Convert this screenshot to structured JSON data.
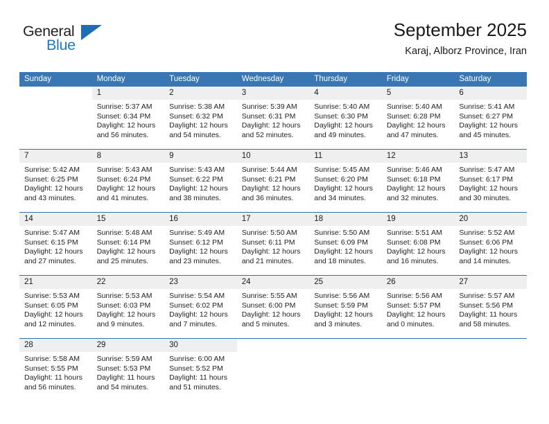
{
  "brand": {
    "name_top": "General",
    "name_bottom": "Blue",
    "triangle_color": "#1c6fb5",
    "text_color": "#231f20",
    "accent_color": "#1c7ac0"
  },
  "header": {
    "title": "September 2025",
    "subtitle": "Karaj, Alborz Province, Iran"
  },
  "theme": {
    "header_bg": "#3877b4",
    "daynum_bg": "#efefef",
    "separator": "#2f6fae",
    "text": "#1a1a1a"
  },
  "weekday_headers": [
    "Sunday",
    "Monday",
    "Tuesday",
    "Wednesday",
    "Thursday",
    "Friday",
    "Saturday"
  ],
  "weeks": [
    [
      {
        "day": "",
        "sunrise": "",
        "sunset": "",
        "daylight_line1": "",
        "daylight_line2": ""
      },
      {
        "day": "1",
        "sunrise": "Sunrise: 5:37 AM",
        "sunset": "Sunset: 6:34 PM",
        "daylight_line1": "Daylight: 12 hours",
        "daylight_line2": "and 56 minutes."
      },
      {
        "day": "2",
        "sunrise": "Sunrise: 5:38 AM",
        "sunset": "Sunset: 6:32 PM",
        "daylight_line1": "Daylight: 12 hours",
        "daylight_line2": "and 54 minutes."
      },
      {
        "day": "3",
        "sunrise": "Sunrise: 5:39 AM",
        "sunset": "Sunset: 6:31 PM",
        "daylight_line1": "Daylight: 12 hours",
        "daylight_line2": "and 52 minutes."
      },
      {
        "day": "4",
        "sunrise": "Sunrise: 5:40 AM",
        "sunset": "Sunset: 6:30 PM",
        "daylight_line1": "Daylight: 12 hours",
        "daylight_line2": "and 49 minutes."
      },
      {
        "day": "5",
        "sunrise": "Sunrise: 5:40 AM",
        "sunset": "Sunset: 6:28 PM",
        "daylight_line1": "Daylight: 12 hours",
        "daylight_line2": "and 47 minutes."
      },
      {
        "day": "6",
        "sunrise": "Sunrise: 5:41 AM",
        "sunset": "Sunset: 6:27 PM",
        "daylight_line1": "Daylight: 12 hours",
        "daylight_line2": "and 45 minutes."
      }
    ],
    [
      {
        "day": "7",
        "sunrise": "Sunrise: 5:42 AM",
        "sunset": "Sunset: 6:25 PM",
        "daylight_line1": "Daylight: 12 hours",
        "daylight_line2": "and 43 minutes."
      },
      {
        "day": "8",
        "sunrise": "Sunrise: 5:43 AM",
        "sunset": "Sunset: 6:24 PM",
        "daylight_line1": "Daylight: 12 hours",
        "daylight_line2": "and 41 minutes."
      },
      {
        "day": "9",
        "sunrise": "Sunrise: 5:43 AM",
        "sunset": "Sunset: 6:22 PM",
        "daylight_line1": "Daylight: 12 hours",
        "daylight_line2": "and 38 minutes."
      },
      {
        "day": "10",
        "sunrise": "Sunrise: 5:44 AM",
        "sunset": "Sunset: 6:21 PM",
        "daylight_line1": "Daylight: 12 hours",
        "daylight_line2": "and 36 minutes."
      },
      {
        "day": "11",
        "sunrise": "Sunrise: 5:45 AM",
        "sunset": "Sunset: 6:20 PM",
        "daylight_line1": "Daylight: 12 hours",
        "daylight_line2": "and 34 minutes."
      },
      {
        "day": "12",
        "sunrise": "Sunrise: 5:46 AM",
        "sunset": "Sunset: 6:18 PM",
        "daylight_line1": "Daylight: 12 hours",
        "daylight_line2": "and 32 minutes."
      },
      {
        "day": "13",
        "sunrise": "Sunrise: 5:47 AM",
        "sunset": "Sunset: 6:17 PM",
        "daylight_line1": "Daylight: 12 hours",
        "daylight_line2": "and 30 minutes."
      }
    ],
    [
      {
        "day": "14",
        "sunrise": "Sunrise: 5:47 AM",
        "sunset": "Sunset: 6:15 PM",
        "daylight_line1": "Daylight: 12 hours",
        "daylight_line2": "and 27 minutes."
      },
      {
        "day": "15",
        "sunrise": "Sunrise: 5:48 AM",
        "sunset": "Sunset: 6:14 PM",
        "daylight_line1": "Daylight: 12 hours",
        "daylight_line2": "and 25 minutes."
      },
      {
        "day": "16",
        "sunrise": "Sunrise: 5:49 AM",
        "sunset": "Sunset: 6:12 PM",
        "daylight_line1": "Daylight: 12 hours",
        "daylight_line2": "and 23 minutes."
      },
      {
        "day": "17",
        "sunrise": "Sunrise: 5:50 AM",
        "sunset": "Sunset: 6:11 PM",
        "daylight_line1": "Daylight: 12 hours",
        "daylight_line2": "and 21 minutes."
      },
      {
        "day": "18",
        "sunrise": "Sunrise: 5:50 AM",
        "sunset": "Sunset: 6:09 PM",
        "daylight_line1": "Daylight: 12 hours",
        "daylight_line2": "and 18 minutes."
      },
      {
        "day": "19",
        "sunrise": "Sunrise: 5:51 AM",
        "sunset": "Sunset: 6:08 PM",
        "daylight_line1": "Daylight: 12 hours",
        "daylight_line2": "and 16 minutes."
      },
      {
        "day": "20",
        "sunrise": "Sunrise: 5:52 AM",
        "sunset": "Sunset: 6:06 PM",
        "daylight_line1": "Daylight: 12 hours",
        "daylight_line2": "and 14 minutes."
      }
    ],
    [
      {
        "day": "21",
        "sunrise": "Sunrise: 5:53 AM",
        "sunset": "Sunset: 6:05 PM",
        "daylight_line1": "Daylight: 12 hours",
        "daylight_line2": "and 12 minutes."
      },
      {
        "day": "22",
        "sunrise": "Sunrise: 5:53 AM",
        "sunset": "Sunset: 6:03 PM",
        "daylight_line1": "Daylight: 12 hours",
        "daylight_line2": "and 9 minutes."
      },
      {
        "day": "23",
        "sunrise": "Sunrise: 5:54 AM",
        "sunset": "Sunset: 6:02 PM",
        "daylight_line1": "Daylight: 12 hours",
        "daylight_line2": "and 7 minutes."
      },
      {
        "day": "24",
        "sunrise": "Sunrise: 5:55 AM",
        "sunset": "Sunset: 6:00 PM",
        "daylight_line1": "Daylight: 12 hours",
        "daylight_line2": "and 5 minutes."
      },
      {
        "day": "25",
        "sunrise": "Sunrise: 5:56 AM",
        "sunset": "Sunset: 5:59 PM",
        "daylight_line1": "Daylight: 12 hours",
        "daylight_line2": "and 3 minutes."
      },
      {
        "day": "26",
        "sunrise": "Sunrise: 5:56 AM",
        "sunset": "Sunset: 5:57 PM",
        "daylight_line1": "Daylight: 12 hours",
        "daylight_line2": "and 0 minutes."
      },
      {
        "day": "27",
        "sunrise": "Sunrise: 5:57 AM",
        "sunset": "Sunset: 5:56 PM",
        "daylight_line1": "Daylight: 11 hours",
        "daylight_line2": "and 58 minutes."
      }
    ],
    [
      {
        "day": "28",
        "sunrise": "Sunrise: 5:58 AM",
        "sunset": "Sunset: 5:55 PM",
        "daylight_line1": "Daylight: 11 hours",
        "daylight_line2": "and 56 minutes."
      },
      {
        "day": "29",
        "sunrise": "Sunrise: 5:59 AM",
        "sunset": "Sunset: 5:53 PM",
        "daylight_line1": "Daylight: 11 hours",
        "daylight_line2": "and 54 minutes."
      },
      {
        "day": "30",
        "sunrise": "Sunrise: 6:00 AM",
        "sunset": "Sunset: 5:52 PM",
        "daylight_line1": "Daylight: 11 hours",
        "daylight_line2": "and 51 minutes."
      },
      {
        "day": "",
        "sunrise": "",
        "sunset": "",
        "daylight_line1": "",
        "daylight_line2": ""
      },
      {
        "day": "",
        "sunrise": "",
        "sunset": "",
        "daylight_line1": "",
        "daylight_line2": ""
      },
      {
        "day": "",
        "sunrise": "",
        "sunset": "",
        "daylight_line1": "",
        "daylight_line2": ""
      },
      {
        "day": "",
        "sunrise": "",
        "sunset": "",
        "daylight_line1": "",
        "daylight_line2": ""
      }
    ]
  ]
}
